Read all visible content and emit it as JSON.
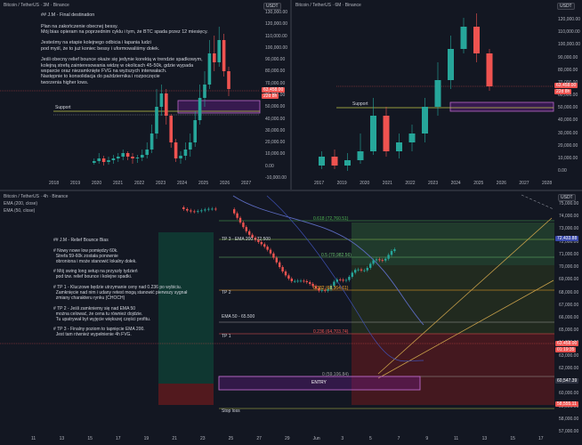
{
  "panels": {
    "p3m": {
      "title": "Bitcoin / TetherUS · 3M · Binance",
      "quote": "USDT",
      "price_axis": [
        "130,000.00",
        "120,000.00",
        "110,000.00",
        "100,000.00",
        "90,000.00",
        "80,000.00",
        "70,000.00",
        "60,000.00",
        "50,000.00",
        "40,000.00",
        "30,000.00",
        "20,000.00",
        "10,000.00",
        "0.00",
        "-10,000.00"
      ],
      "time_axis": [
        "2018",
        "2019",
        "2020",
        "2021",
        "2022",
        "2023",
        "2024",
        "2025",
        "2026",
        "2027"
      ],
      "price_tag": "63,458.00",
      "price_tag_sub": "22d 8h",
      "support_label": "Support",
      "note": "## J.M - Final destination\n\nPlan na zakończenie obecnej bessy.\nMój bias opieram na poprzednim cyklu i tym, że BTC spada przez 12 miesięcy.\n\nJesteśmy na etapie kolejnego odbicia i łapania ludzi\npod myśl, że to już koniec bessy i uformowaliśmy dołek.\n\nJeśli obecny relief bounce okaże się jedynie korektą w trendzie spadkowym,\nkolejną strefą zainteresowania widzę w okolicach 45-50k, gdzie wypada\nwsparcie oraz niezamknięte FVG na wyższych interwałach.\nNastępnie to konsolidacja do października i rozpoczęcie\ntworzenia higher lows."
    },
    "p6m": {
      "title": "Bitcoin / TetherUS · 6M · Binance",
      "quote": "USDT",
      "price_axis": [
        "120,000.00",
        "110,000.00",
        "100,000.00",
        "90,000.00",
        "80,000.00",
        "70,000.00",
        "60,000.00",
        "50,000.00",
        "40,000.00",
        "30,000.00",
        "20,000.00",
        "10,000.00",
        "0.00"
      ],
      "time_axis": [
        "2017",
        "2019",
        "2020",
        "2021",
        "2022",
        "2023",
        "2024",
        "2025",
        "2026",
        "2027",
        "2028"
      ],
      "price_tag": "63,458.00",
      "price_tag_sub": "22d 8h",
      "support_label": "Support"
    },
    "p4h": {
      "title": "Bitcoin / TetherUS · 4h · Binance",
      "legend": [
        "EMA (200, close)",
        "EMA (50, close)"
      ],
      "quote": "USDT",
      "price_axis": [
        "75,000.00",
        "74,000.00",
        "73,000.00",
        "72,000.00",
        "71,000.00",
        "70,000.00",
        "69,000.00",
        "68,000.00",
        "67,000.00",
        "66,000.00",
        "65,000.00",
        "64,000.00",
        "63,000.00",
        "62,000.00",
        "61,000.00",
        "60,000.00",
        "59,000.00",
        "58,000.00",
        "57,000.00"
      ],
      "time_axis": [
        "11",
        "13",
        "15",
        "17",
        "19",
        "21",
        "23",
        "25",
        "27",
        "29",
        "Jun",
        "3",
        "5",
        "7",
        "9",
        "11",
        "13",
        "15",
        "17"
      ],
      "tags": {
        "ema200": "72,433.88",
        "price": "63,458.00",
        "price_sub": "01:19:35",
        "ema50": "60,547.39",
        "stop": "58,555.11"
      },
      "fib_labels": {
        "f618": "0.618 (72,760.51)",
        "f5": "0.5 (70,982.56)",
        "f382": "0.382 (68,364.61)",
        "f236": "0.236 (64,703.74)",
        "f0": "0 (59,106.84)"
      },
      "levels": {
        "tp3": "TP 3 - EMA 200 - 72.500",
        "tp2": "TP 2",
        "ema50": "EMA 50 - 65.500",
        "tp1": "TP 1",
        "entry": "ENTRY",
        "stop": "Stop loss"
      },
      "note": "## J.M - Relief Bounce Bias\n\n# Nowy nowe low pomiędzy 60k.\n  Strefa 59-60k została ponownie\n  obroniona i może stanowić lokalny dołek.\n\n# Mój swing long setup na przyszły tydzień\n  pod tzw. relief bounce i kolejne spadki.\n\n# TP 1 - Kluczowe będzie utrzymanie ceny nad 0.236 po wybiciu.\n  Zamknięcie nad nim i udany retest mogą stanowić pierwszy sygnał\n  zmiany charakteru rynku (CHOCH)\n\n# TP 2 - Jeśli zamkniemy się nad EMA 50\n  można celować, że cena tu również dojdzie.\n  Tu upatrywał byt wyjęcie większej części profitu.\n\n# TP 3 - Finalny poziom to tapnięcie EMA 200.\n  Jest tam również wypełnienie 4h FVG."
    }
  },
  "colors": {
    "bg": "#131722",
    "up": "#26a69a",
    "down": "#ef5350",
    "support": "#b6c14a",
    "box": "#9c27b0",
    "target_zone": "#1b5e20",
    "stop_zone": "#7f1d1d"
  }
}
